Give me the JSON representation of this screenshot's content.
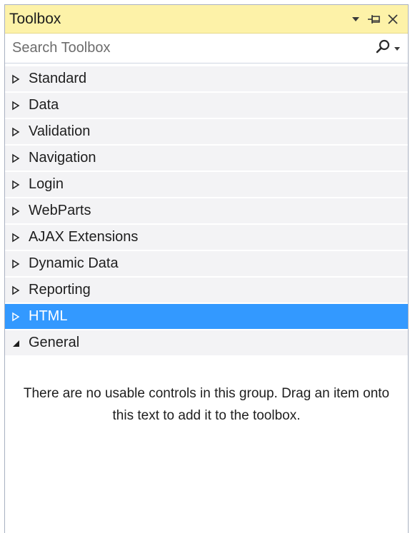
{
  "window": {
    "title": "Toolbox",
    "icons": [
      "dropdown-arrow-icon",
      "pin-icon",
      "close-icon"
    ]
  },
  "search": {
    "placeholder": "Search Toolbox",
    "icon": "search-icon"
  },
  "groups": [
    {
      "label": "Standard",
      "expanded": false,
      "selected": false
    },
    {
      "label": "Data",
      "expanded": false,
      "selected": false
    },
    {
      "label": "Validation",
      "expanded": false,
      "selected": false
    },
    {
      "label": "Navigation",
      "expanded": false,
      "selected": false
    },
    {
      "label": "Login",
      "expanded": false,
      "selected": false
    },
    {
      "label": "WebParts",
      "expanded": false,
      "selected": false
    },
    {
      "label": "AJAX Extensions",
      "expanded": false,
      "selected": false
    },
    {
      "label": "Dynamic Data",
      "expanded": false,
      "selected": false
    },
    {
      "label": "Reporting",
      "expanded": false,
      "selected": false
    },
    {
      "label": "HTML",
      "expanded": false,
      "selected": true
    },
    {
      "label": "General",
      "expanded": true,
      "selected": false
    }
  ],
  "general_empty_message": "There are no usable controls in this group. Drag an item onto this text to add it to the toolbox.",
  "colors": {
    "title_bar": "#fdf2a8",
    "selected": "#3399ff",
    "group_bg": "#f3f3f5"
  }
}
